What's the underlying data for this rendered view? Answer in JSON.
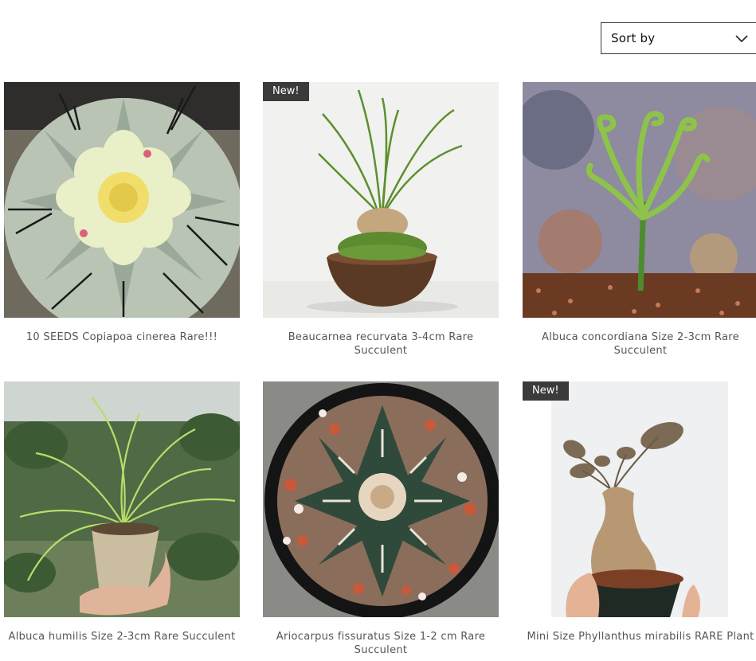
{
  "sort": {
    "label": "Sort by"
  },
  "products": [
    {
      "title": "10 SEEDS Copiapoa cinerea Rare!!!",
      "badge": "",
      "image": "copiapoa-cactus-flower-photo"
    },
    {
      "title": "Beaucarnea recurvata 3-4cm Rare Succulent",
      "badge": "New!",
      "image": "beaucarnea-in-bowl-photo"
    },
    {
      "title": "Albuca concordiana Size 2-3cm Rare Succulent",
      "badge": "",
      "image": "albuca-spiral-leaves-photo"
    },
    {
      "title": "Albuca humilis Size 2-3cm Rare Succulent",
      "badge": "",
      "image": "albuca-humilis-pot-photo"
    },
    {
      "title": "Ariocarpus fissuratus Size 1-2 cm Rare Succulent",
      "badge": "",
      "image": "ariocarpus-cactus-photo"
    },
    {
      "title": "Mini Size Phyllanthus mirabilis RARE Plant",
      "badge": "New!",
      "image": "phyllanthus-caudex-photo"
    }
  ]
}
